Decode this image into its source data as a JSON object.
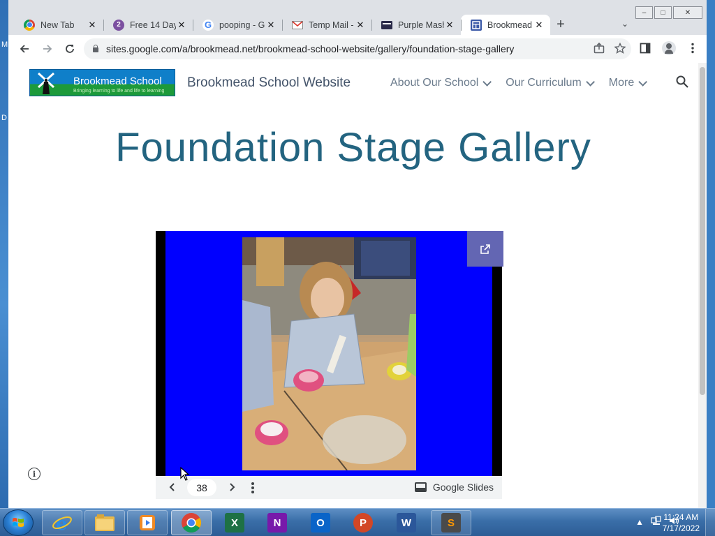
{
  "desktop": {
    "glyph_top": "M",
    "glyph_mid": "D"
  },
  "browser": {
    "tabs": [
      {
        "title": "New Tab",
        "icon": "chrome-icon",
        "active": false
      },
      {
        "title": "Free 14 Day",
        "icon": "number-2-icon",
        "badge": "2",
        "active": false
      },
      {
        "title": "pooping - G",
        "icon": "google-icon",
        "badge": "G",
        "active": false
      },
      {
        "title": "Temp Mail -",
        "icon": "mail-icon",
        "active": false
      },
      {
        "title": "Purple Mash",
        "icon": "purple-mash-icon",
        "active": false
      },
      {
        "title": "Brookmead",
        "icon": "google-sites-icon",
        "active": true
      }
    ],
    "new_tab_label": "+",
    "window_controls": {
      "minimize": "–",
      "maximize": "□",
      "close": "✕"
    },
    "url": "sites.google.com/a/brookmead.net/brookmead-school-website/gallery/foundation-stage-gallery"
  },
  "site": {
    "logo_name": "Brookmead School",
    "logo_tagline": "Bringing learning to life and life to learning",
    "name": "Brookmead School Website",
    "nav": [
      {
        "label": "About Our School"
      },
      {
        "label": "Our Curriculum"
      },
      {
        "label": "More"
      }
    ],
    "page_title": "Foundation Stage Gallery"
  },
  "slides": {
    "slide_number": "38",
    "brand": "Google Slides",
    "background_color": "#0000ff",
    "popout_color": "#6366b3"
  },
  "taskbar": {
    "apps": [
      {
        "name": "internet-explorer"
      },
      {
        "name": "file-explorer"
      },
      {
        "name": "media-player"
      },
      {
        "name": "chrome",
        "active": true
      },
      {
        "name": "excel",
        "letter": "X"
      },
      {
        "name": "onenote",
        "letter": "N"
      },
      {
        "name": "outlook",
        "letter": "O"
      },
      {
        "name": "powerpoint",
        "letter": "P"
      },
      {
        "name": "word",
        "letter": "W"
      },
      {
        "name": "sublime-text",
        "letter": "S"
      }
    ],
    "clock_time": "11:24 AM",
    "clock_date": "7/17/2022"
  }
}
